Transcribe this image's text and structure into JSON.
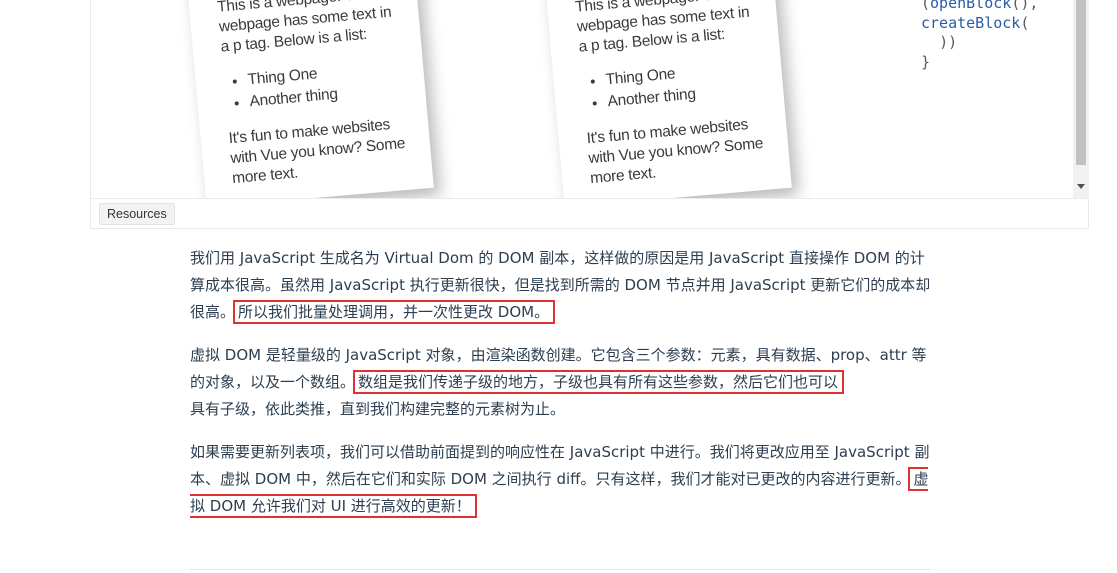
{
  "demo": {
    "card_intro": "This is a webpage. This webpage has some text in a p tag. Below is a list:",
    "list_items": [
      "Thing One",
      "Another thing"
    ],
    "card_outro": "It's fun to make websites with Vue you know? Some more text.",
    "code_lines": [
      {
        "open": "(",
        "fn": "openBlock",
        "close": "(),"
      },
      {
        "open": "",
        "fn": "createBlock",
        "close": "("
      },
      {
        "open": "  ",
        "fn": "",
        "close": "))"
      },
      {
        "open": "}",
        "fn": "",
        "close": ""
      }
    ]
  },
  "tabs": {
    "resources": "Resources"
  },
  "article": {
    "p1_before": "我们用 JavaScript 生成名为 Virtual Dom 的 DOM 副本，这样做的原因是用 JavaScript 直接操作 DOM 的计算成本很高。虽然用 JavaScript 执行更新很快，但是找到所需的 DOM 节点并用 JavaScript 更新它们的成本却很高。",
    "p1_highlight": "所以我们批量处理调用，并一次性更改 DOM。",
    "p2_before": "虚拟 DOM 是轻量级的 JavaScript 对象，由渲染函数创建。它包含三个参数：元素，具有数据、prop、attr 等的对象，以及一个数组。",
    "p2_highlight": "数组是我们传递子级的地方，子级也具有所有这些参数，然后它们也可以",
    "p2_after": "具有子级，依此类推，直到我们构建完整的元素树为止。",
    "p3_before": "如果需要更新列表项，我们可以借助前面提到的响应性在 JavaScript 中进行。我们将更改应用至 JavaScript 副本、虚拟 DOM 中，然后在它们和实际 DOM 之间执行 diff。只有这样，我们才能对已更改的内容进行更新。",
    "p3_highlight": "虚拟 DOM 允许我们对 UI 进行高效的更新！"
  },
  "colors": {
    "highlight_border": "#e03131",
    "text": "#2c3e50",
    "code_fn": "#2a5da8"
  }
}
